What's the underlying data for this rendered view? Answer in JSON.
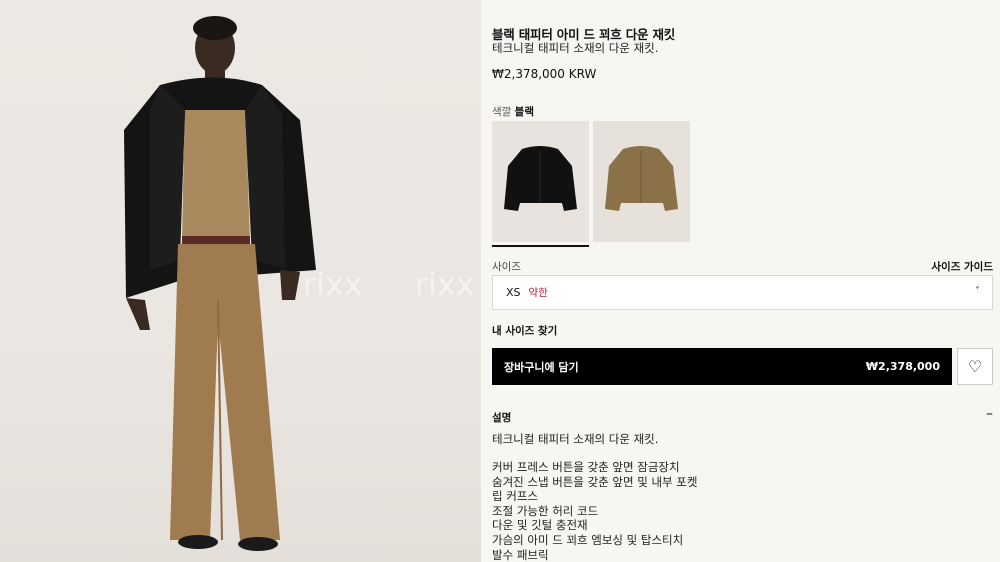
{
  "product": {
    "title": "블랙 태피터 아미 드 꾀흐 다운 재킷",
    "subtitle": "테크니컬 태피터 소재의 다운 재킷.",
    "price": "₩2,378,000 KRW"
  },
  "color": {
    "label": "색깔",
    "selected": "블랙",
    "swatches": [
      {
        "name": "black-jacket",
        "color": "#111111"
      },
      {
        "name": "camel-jacket",
        "color": "#8a7148"
      }
    ]
  },
  "size": {
    "label": "사이즈",
    "guide": "사이즈 가이드",
    "selected": "XS",
    "stock": "약한",
    "chevron": "˅"
  },
  "find_size": "내 사이즈 찾기",
  "cart": {
    "label": "장바구니에 담기",
    "price": "₩2,378,000"
  },
  "wishlist_icon": "♡",
  "description": {
    "title": "설명",
    "toggle": "–",
    "intro": "테크니컬 태피터 소재의 다운 재킷.",
    "items": [
      "커버 프레스 버튼을 갖춘 앞면 잠금장치",
      "숨겨진 스냅 버튼을 갖춘 앞면 및 내부 포켓",
      "립 커프스",
      "조절 가능한 허리 코드",
      "다운 및 깃털 충전재",
      "가슴의 아미 드 꾀흐 엠보싱 및 탑스티치",
      "발수 패브릭"
    ]
  },
  "watermark": "rixx"
}
